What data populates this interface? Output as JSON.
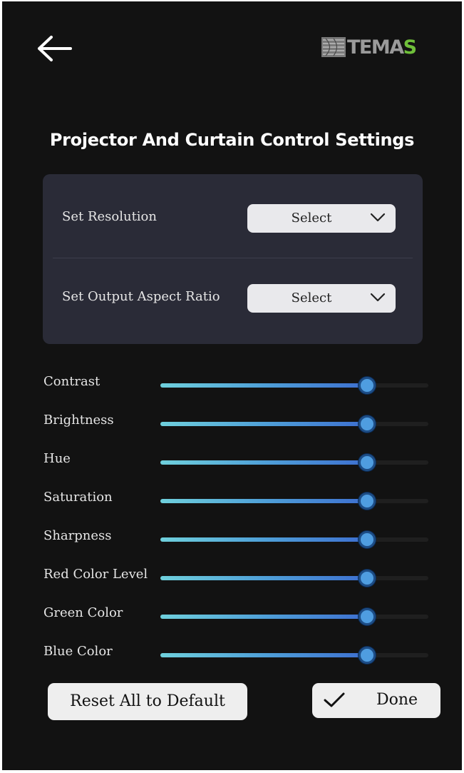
{
  "header": {
    "back_icon": "arrow-left-icon",
    "logo": {
      "text_main": "TEMA",
      "text_accent": "S",
      "accent_color": "#6fbf3a"
    }
  },
  "title": "Projector And Curtain Control Settings",
  "panel": {
    "resolution": {
      "label": "Set Resolution",
      "value": "Select",
      "icon": "chevron-down-icon"
    },
    "aspect_ratio": {
      "label": "Set Output Aspect Ratio",
      "value": "Select",
      "icon": "chevron-down-icon"
    }
  },
  "sliders": [
    {
      "label": "Contrast",
      "value": 0.77
    },
    {
      "label": "Brightness",
      "value": 0.77
    },
    {
      "label": "Hue",
      "value": 0.77
    },
    {
      "label": "Saturation",
      "value": 0.77
    },
    {
      "label": "Sharpness",
      "value": 0.77
    },
    {
      "label": "Red Color Level",
      "value": 0.77
    },
    {
      "label": "Green Color",
      "value": 0.77
    },
    {
      "label": "Blue Color",
      "value": 0.77
    }
  ],
  "buttons": {
    "reset_label": "Reset All to Default",
    "done_label": "Done",
    "done_icon": "checkmark-icon"
  },
  "colors": {
    "background": "#121212",
    "panel": "#2a2b37",
    "accent": "#4f9de0"
  }
}
